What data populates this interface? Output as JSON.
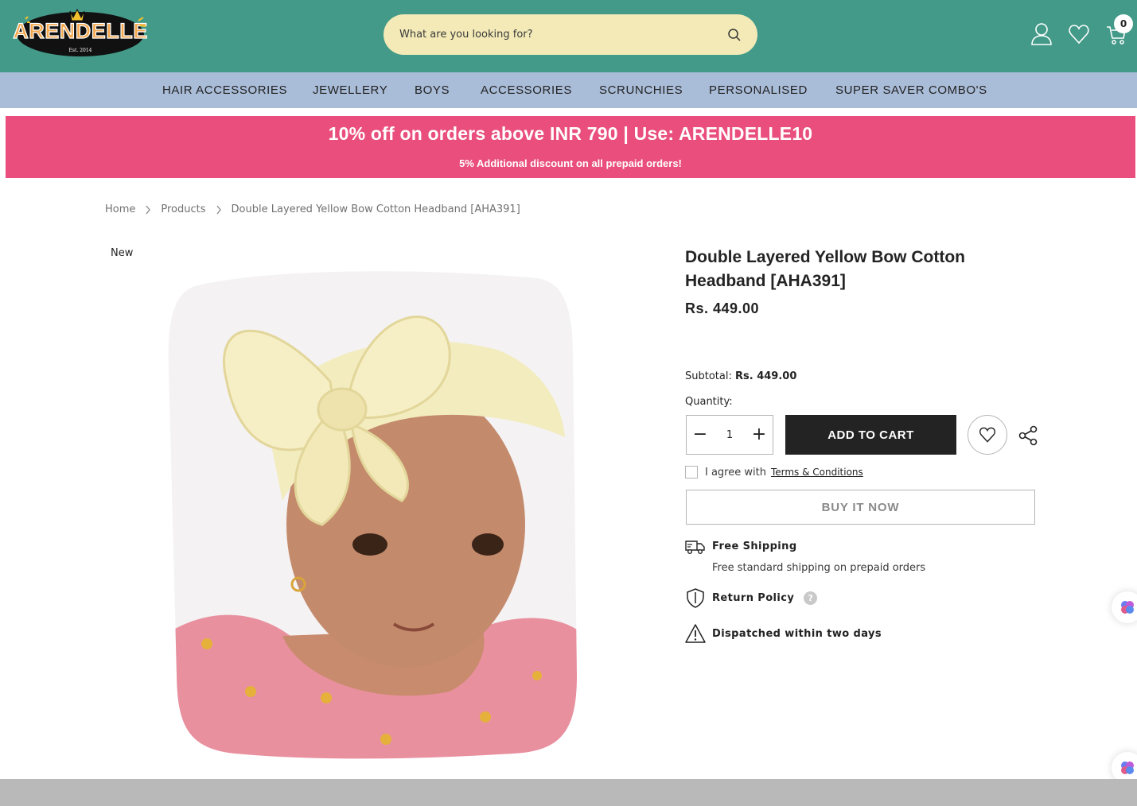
{
  "header": {
    "logo_text": "ARENDELLE",
    "logo_tagline": "Est. 2014",
    "search_placeholder": "What are you looking for?",
    "cart_count": "0",
    "icons": [
      "account-icon",
      "wishlist-icon",
      "cart-icon",
      "search-icon"
    ]
  },
  "nav": {
    "items": [
      {
        "label": "HAIR ACCESSORIES"
      },
      {
        "label": "JEWELLERY"
      },
      {
        "label": "BOYS"
      },
      {
        "label": "ACCESSORIES"
      },
      {
        "label": "SCRUNCHIES"
      },
      {
        "label": "PERSONALISED"
      },
      {
        "label": "SUPER SAVER COMBO'S"
      }
    ]
  },
  "promo": {
    "main": "10% off on orders above INR 790 | Use: ARENDELLE10",
    "sub": "5% Additional discount on all prepaid orders!"
  },
  "breadcrumb": {
    "home": "Home",
    "products": "Products",
    "current": "Double Layered Yellow Bow Cotton Headband [AHA391]"
  },
  "product": {
    "badge": "New",
    "title": "Double Layered Yellow Bow Cotton Headband [AHA391]",
    "price": "Rs. 449.00",
    "subtotal_label": "Subtotal:",
    "subtotal_value": "Rs. 449.00",
    "quantity_label": "Quantity:",
    "quantity": "1",
    "qty_minus": "−",
    "qty_plus": "+",
    "add_to_cart": "ADD TO CART",
    "agree_text": "I agree with",
    "terms_link": "Terms & Conditions",
    "buy_now": "BUY IT NOW"
  },
  "info": {
    "shipping_title": "Free Shipping",
    "shipping_desc": "Free standard shipping on prepaid orders",
    "return_title": "Return Policy",
    "help": "?",
    "dispatch_title": "Dispatched within two days"
  },
  "colors": {
    "header_bg": "#439a88",
    "search_bg": "#f3eab7",
    "nav_bg": "#a9bcd8",
    "promo_bg": "#e94e7c",
    "button_dark": "#232323"
  }
}
